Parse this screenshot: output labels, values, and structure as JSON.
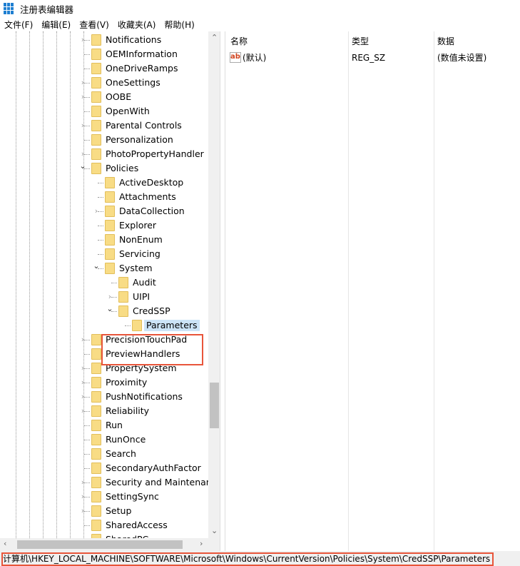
{
  "window": {
    "title": "注册表编辑器"
  },
  "menu": [
    "文件(F)",
    "编辑(E)",
    "查看(V)",
    "收藏夹(A)",
    "帮助(H)"
  ],
  "tree": [
    {
      "label": "Notifications",
      "level": 0,
      "expander": "collapsed"
    },
    {
      "label": "OEMInformation",
      "level": 0,
      "expander": "none"
    },
    {
      "label": "OneDriveRamps",
      "level": 0,
      "expander": "none"
    },
    {
      "label": "OneSettings",
      "level": 0,
      "expander": "collapsed"
    },
    {
      "label": "OOBE",
      "level": 0,
      "expander": "collapsed"
    },
    {
      "label": "OpenWith",
      "level": 0,
      "expander": "none"
    },
    {
      "label": "Parental Controls",
      "level": 0,
      "expander": "collapsed"
    },
    {
      "label": "Personalization",
      "level": 0,
      "expander": "none"
    },
    {
      "label": "PhotoPropertyHandler",
      "level": 0,
      "expander": "collapsed"
    },
    {
      "label": "Policies",
      "level": 0,
      "expander": "expanded"
    },
    {
      "label": "ActiveDesktop",
      "level": 1,
      "expander": "none"
    },
    {
      "label": "Attachments",
      "level": 1,
      "expander": "none"
    },
    {
      "label": "DataCollection",
      "level": 1,
      "expander": "collapsed"
    },
    {
      "label": "Explorer",
      "level": 1,
      "expander": "none"
    },
    {
      "label": "NonEnum",
      "level": 1,
      "expander": "none"
    },
    {
      "label": "Servicing",
      "level": 1,
      "expander": "none"
    },
    {
      "label": "System",
      "level": 1,
      "expander": "expanded"
    },
    {
      "label": "Audit",
      "level": 2,
      "expander": "none"
    },
    {
      "label": "UIPI",
      "level": 2,
      "expander": "collapsed"
    },
    {
      "label": "CredSSP",
      "level": 2,
      "expander": "expanded"
    },
    {
      "label": "Parameters",
      "level": 3,
      "expander": "none",
      "selected": true
    },
    {
      "label": "PrecisionTouchPad",
      "level": 0,
      "expander": "collapsed"
    },
    {
      "label": "PreviewHandlers",
      "level": 0,
      "expander": "none"
    },
    {
      "label": "PropertySystem",
      "level": 0,
      "expander": "collapsed"
    },
    {
      "label": "Proximity",
      "level": 0,
      "expander": "collapsed"
    },
    {
      "label": "PushNotifications",
      "level": 0,
      "expander": "collapsed"
    },
    {
      "label": "Reliability",
      "level": 0,
      "expander": "collapsed"
    },
    {
      "label": "Run",
      "level": 0,
      "expander": "none"
    },
    {
      "label": "RunOnce",
      "level": 0,
      "expander": "none"
    },
    {
      "label": "Search",
      "level": 0,
      "expander": "none"
    },
    {
      "label": "SecondaryAuthFactor",
      "level": 0,
      "expander": "none"
    },
    {
      "label": "Security and Maintenance",
      "level": 0,
      "expander": "collapsed"
    },
    {
      "label": "SettingSync",
      "level": 0,
      "expander": "collapsed"
    },
    {
      "label": "Setup",
      "level": 0,
      "expander": "collapsed"
    },
    {
      "label": "SharedAccess",
      "level": 0,
      "expander": "none"
    },
    {
      "label": "SharedPC",
      "level": 0,
      "expander": "none"
    }
  ],
  "values": {
    "columns": [
      "名称",
      "类型",
      "数据"
    ],
    "rows": [
      {
        "name": "(默认)",
        "type": "REG_SZ",
        "data": "(数值未设置)",
        "icon": "ab-string-icon"
      }
    ]
  },
  "status": {
    "path": "计算机\\HKEY_LOCAL_MACHINE\\SOFTWARE\\Microsoft\\Windows\\CurrentVersion\\Policies\\System\\CredSSP\\Parameters"
  },
  "colors": {
    "highlight": "#e8553a",
    "selection": "#cce4f7",
    "folder": "#f8dc85"
  }
}
